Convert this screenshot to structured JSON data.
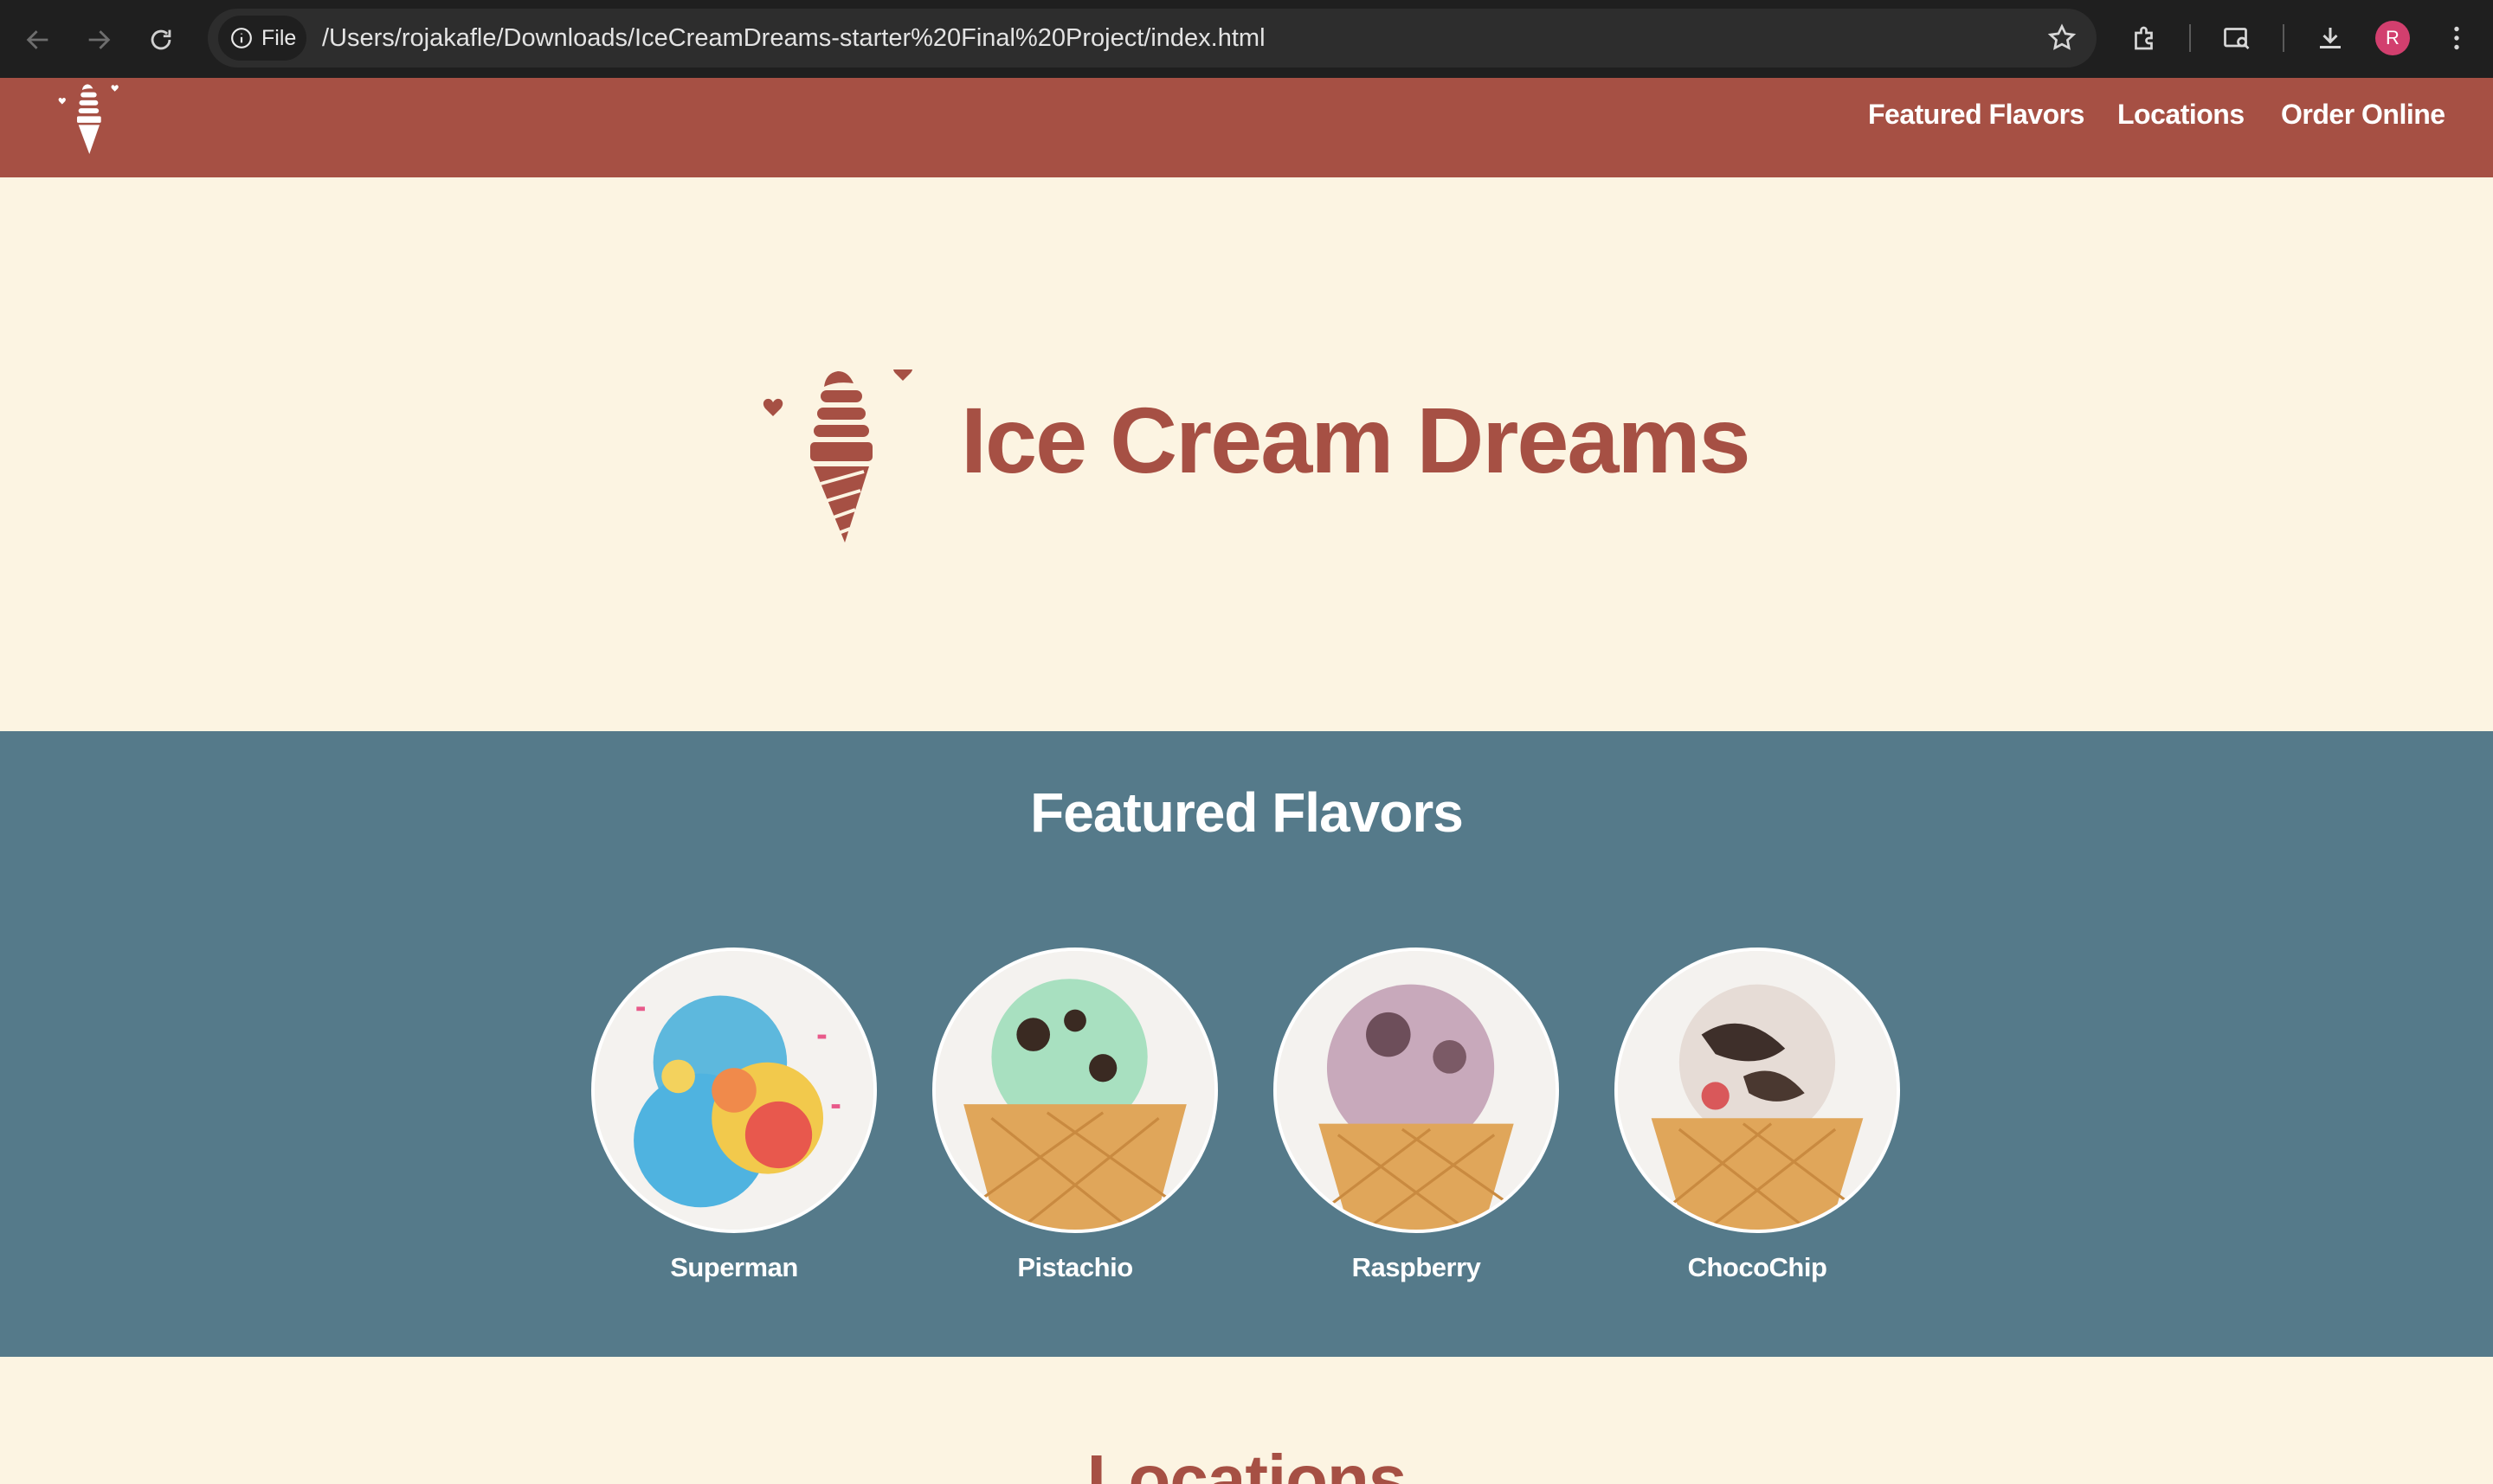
{
  "browser": {
    "file_chip_label": "File",
    "url": "/Users/rojakafle/Downloads/IceCreamDreams-starter%20Final%20Project/index.html",
    "profile_initial": "R"
  },
  "header": {
    "nav": [
      "Featured Flavors",
      "Locations",
      "Order Online"
    ]
  },
  "hero": {
    "title": "Ice Cream Dreams"
  },
  "featured": {
    "title": "Featured Flavors",
    "flavors": [
      {
        "name": "Superman"
      },
      {
        "name": "Pistachio"
      },
      {
        "name": "Raspberry"
      },
      {
        "name": "ChocoChip"
      }
    ]
  },
  "locations": {
    "title": "Locations"
  },
  "colors": {
    "brand_red": "#a65044",
    "cream": "#fcf4e2",
    "slate_blue": "#557a8a"
  }
}
